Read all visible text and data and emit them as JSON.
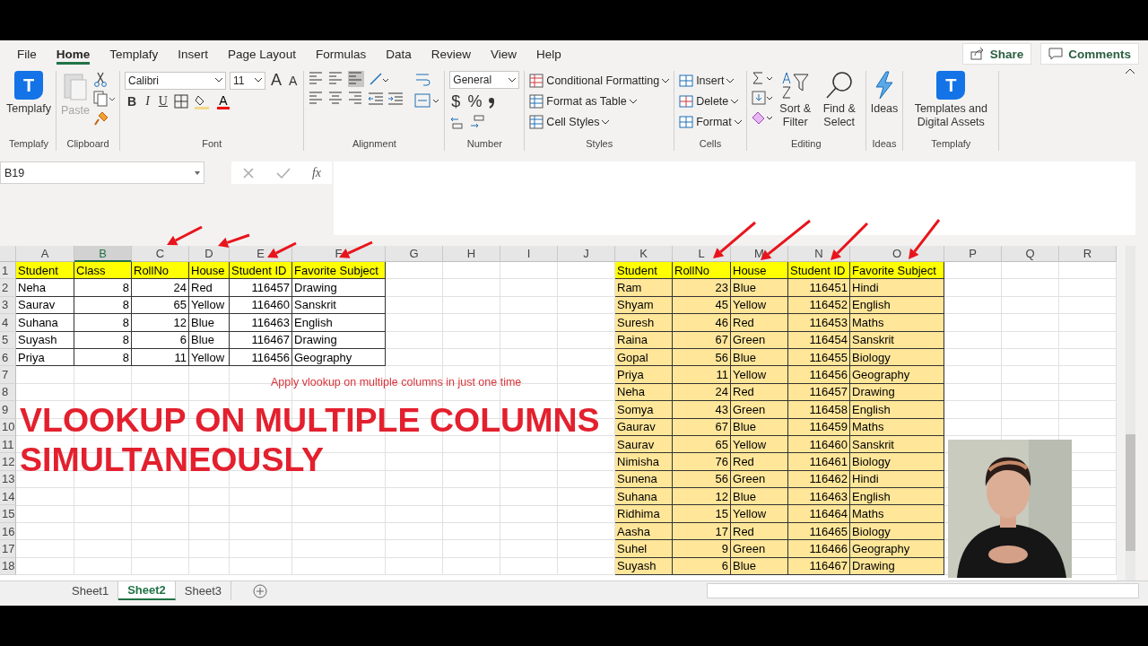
{
  "ribbon_tabs": [
    {
      "label": "File",
      "selected": false
    },
    {
      "label": "Home",
      "selected": true
    },
    {
      "label": "Templafy",
      "selected": false
    },
    {
      "label": "Insert",
      "selected": false
    },
    {
      "label": "Page Layout",
      "selected": false
    },
    {
      "label": "Formulas",
      "selected": false
    },
    {
      "label": "Data",
      "selected": false
    },
    {
      "label": "Review",
      "selected": false
    },
    {
      "label": "View",
      "selected": false
    },
    {
      "label": "Help",
      "selected": false
    }
  ],
  "share_button": "Share",
  "comments_button": "Comments",
  "ribbon_groups": [
    {
      "kind": "templafy",
      "label": "Templafy",
      "logo": "T",
      "button": "Templafy"
    },
    {
      "kind": "clipboard",
      "label": "Clipboard",
      "paste": "Paste"
    },
    {
      "kind": "font",
      "label": "Font",
      "family": "Calibri",
      "size": "11",
      "grow": "A",
      "shrink": "A",
      "bold": "B",
      "italic": "I",
      "underline": "U",
      "color_glyph": "A"
    },
    {
      "kind": "alignment",
      "label": "Alignment"
    },
    {
      "kind": "number",
      "label": "Number",
      "format": "General",
      "currency": "$",
      "percent": "%"
    },
    {
      "kind": "styles",
      "label": "Styles",
      "commands": [
        "Conditional Formatting",
        "Format as Table",
        "Cell Styles"
      ]
    },
    {
      "kind": "cells",
      "label": "Cells",
      "commands": [
        "Insert",
        "Delete",
        "Format"
      ]
    },
    {
      "kind": "editing",
      "label": "Editing",
      "commands": [
        "Sort & Filter",
        "Find & Select"
      ]
    },
    {
      "kind": "ideas",
      "label": "Ideas",
      "button": "Ideas"
    },
    {
      "kind": "templafy",
      "label": "Templafy",
      "logo": "T",
      "button": "Templates and Digital Assets"
    }
  ],
  "formula_bar": {
    "name_box": "B19",
    "function_glyph": "fx"
  },
  "sheet": {
    "columns": [
      {
        "label": "A",
        "selected": false
      },
      {
        "label": "B",
        "selected": true
      },
      {
        "label": "C",
        "selected": false
      },
      {
        "label": "D",
        "selected": false
      },
      {
        "label": "E",
        "selected": false
      },
      {
        "label": "F",
        "selected": false
      },
      {
        "label": "G",
        "selected": false
      },
      {
        "label": "H",
        "selected": false
      },
      {
        "label": "I",
        "selected": false
      },
      {
        "label": "J",
        "selected": false
      },
      {
        "label": "K",
        "selected": false
      },
      {
        "label": "L",
        "selected": false
      },
      {
        "label": "M",
        "selected": false
      },
      {
        "label": "N",
        "selected": false
      },
      {
        "label": "O",
        "selected": false
      },
      {
        "label": "P",
        "selected": false
      },
      {
        "label": "Q",
        "selected": false
      },
      {
        "label": "R",
        "selected": false
      }
    ],
    "rows": [
      "1",
      "2",
      "3",
      "4",
      "5",
      "6",
      "7",
      "8",
      "9",
      "10",
      "11",
      "12",
      "13",
      "14",
      "15",
      "16",
      "17",
      "18"
    ],
    "left_table": {
      "columns": [
        "Student",
        "Class",
        "RollNo",
        "House",
        "Student ID",
        "Favorite Subject"
      ],
      "rows": [
        [
          "Neha",
          "8",
          "24",
          "Red",
          "116457",
          "Drawing"
        ],
        [
          "Saurav",
          "8",
          "65",
          "Yellow",
          "116460",
          "Sanskrit"
        ],
        [
          "Suhana",
          "8",
          "12",
          "Blue",
          "116463",
          "English"
        ],
        [
          "Suyash",
          "8",
          "6",
          "Blue",
          "116467",
          "Drawing"
        ],
        [
          "Priya",
          "8",
          "11",
          "Yellow",
          "116456",
          "Geography"
        ]
      ]
    },
    "right_table": {
      "columns": [
        "Student",
        "RollNo",
        "House",
        "Student ID",
        "Favorite Subject"
      ],
      "rows": [
        [
          "Ram",
          "23",
          "Blue",
          "116451",
          "Hindi"
        ],
        [
          "Shyam",
          "45",
          "Yellow",
          "116452",
          "English"
        ],
        [
          "Suresh",
          "46",
          "Red",
          "116453",
          "Maths"
        ],
        [
          "Raina",
          "67",
          "Green",
          "116454",
          "Sanskrit"
        ],
        [
          "Gopal",
          "56",
          "Blue",
          "116455",
          "Biology"
        ],
        [
          "Priya",
          "11",
          "Yellow",
          "116456",
          "Geography"
        ],
        [
          "Neha",
          "24",
          "Red",
          "116457",
          "Drawing"
        ],
        [
          "Somya",
          "43",
          "Green",
          "116458",
          "English"
        ],
        [
          "Gaurav",
          "67",
          "Blue",
          "116459",
          "Maths"
        ],
        [
          "Saurav",
          "65",
          "Yellow",
          "116460",
          "Sanskrit"
        ],
        [
          "Nimisha",
          "76",
          "Red",
          "116461",
          "Biology"
        ],
        [
          "Sunena",
          "56",
          "Green",
          "116462",
          "Hindi"
        ],
        [
          "Suhana",
          "12",
          "Blue",
          "116463",
          "English"
        ],
        [
          "Ridhima",
          "15",
          "Yellow",
          "116464",
          "Maths"
        ],
        [
          "Aasha",
          "17",
          "Red",
          "116465",
          "Biology"
        ],
        [
          "Suhel",
          "9",
          "Green",
          "116466",
          "Geography"
        ],
        [
          "Suyash",
          "6",
          "Blue",
          "116467",
          "Drawing"
        ]
      ]
    },
    "note": "Apply vlookup on multiple columns in just one time",
    "title_lines": [
      "VLOOKUP ON MULTIPLE COLUMNS",
      "SIMULTANEOUSLY"
    ],
    "photo": {
      "kind": "picture"
    }
  },
  "sheet_tabs": [
    {
      "label": "Sheet1",
      "selected": false
    },
    {
      "label": "Sheet2",
      "selected": true
    },
    {
      "label": "Sheet3",
      "selected": false
    }
  ]
}
